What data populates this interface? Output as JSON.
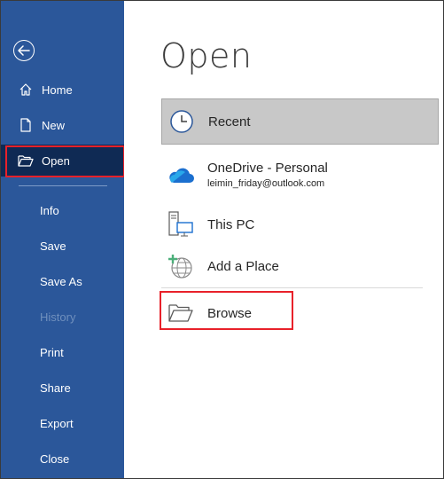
{
  "sidebar": {
    "back_icon": "back-arrow-icon",
    "items": [
      {
        "label": "Home",
        "icon": "home-icon"
      },
      {
        "label": "New",
        "icon": "new-document-icon"
      },
      {
        "label": "Open",
        "icon": "open-folder-icon",
        "selected": true
      },
      {
        "label": "Info"
      },
      {
        "label": "Save"
      },
      {
        "label": "Save As"
      },
      {
        "label": "History",
        "disabled": true
      },
      {
        "label": "Print"
      },
      {
        "label": "Share"
      },
      {
        "label": "Export"
      },
      {
        "label": "Close"
      }
    ],
    "colors": {
      "background": "#2b579a",
      "selected": "#0f2a54",
      "disabled_text": "#6f8fbd"
    }
  },
  "main": {
    "title": "Open",
    "locations": {
      "recent": {
        "label": "Recent",
        "icon": "clock-icon"
      },
      "onedrive": {
        "label": "OneDrive - Personal",
        "account": "leimin_friday@outlook.com",
        "icon": "cloud-icon"
      },
      "this_pc": {
        "label": "This PC",
        "icon": "computer-icon"
      },
      "add_place": {
        "label": "Add a Place",
        "icon": "add-globe-icon"
      },
      "browse": {
        "label": "Browse",
        "icon": "folder-icon"
      }
    }
  },
  "annotations": {
    "highlight_color": "#e8212a"
  }
}
